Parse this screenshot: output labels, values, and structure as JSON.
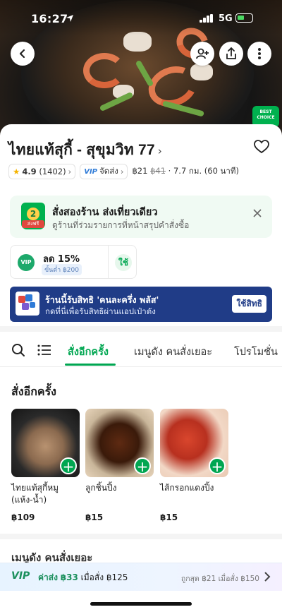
{
  "status_bar": {
    "time": "16:27",
    "network": "5G"
  },
  "store": {
    "name": "ไทยแท้สุกี้ - สุขุมวิท 77",
    "rating": "4.9",
    "review_count": "(1402)",
    "vip_label": "VIP",
    "delivery_label": "จัดส่ง",
    "delivery_fee": "฿21",
    "delivery_fee_original": "฿41",
    "distance_time": "· 7.7 กม. (60 นาที)",
    "badge_text": "BEST CHOICE"
  },
  "promo_banner": {
    "bag_number": "2",
    "bag_tag": "ส่งฟรี",
    "title": "สั่งสองร้าน ส่งเที่ยวเดียว",
    "subtitle": "ดูร้านที่ร่วมรายการที่หน้าสรุปคำสั่งซื้อ"
  },
  "voucher": {
    "badge": "VIP",
    "discount": "ลด 15%",
    "minimum": "ขั้นต่ำ ฿200",
    "use_label": "ใช้"
  },
  "rights_banner": {
    "line1": "ร้านนี้รับสิทธิ 'คนละครึ่ง พลัส'",
    "line2": "กดที่นี่เพื่อรับสิทธิผ่านแอปเป๋าตัง",
    "button": "ใช้สิทธิ"
  },
  "tabs": [
    {
      "label": "สั่งอีกครั้ง"
    },
    {
      "label": "เมนูดัง คนสั่งเยอะ"
    },
    {
      "label": "โปรโมชั่น"
    }
  ],
  "section_title": "สั่งอีกครั้ง",
  "items": [
    {
      "name": "ไทยแท้สุกี้หมู (แห้ง-น้ำ)",
      "price": "฿109"
    },
    {
      "name": "ลูกชิ้นปิ้ง",
      "price": "฿15"
    },
    {
      "name": "ไส้กรอกแดงปิ้ง",
      "price": "฿15"
    }
  ],
  "next_section_peek": "เมนูดัง คนสั่งเยอะ",
  "vip_bar": {
    "tag": "VIP",
    "main_prefix": "ค่าส่ง",
    "main_amount": "฿33",
    "main_suffix": "เมื่อสั่ง ฿125",
    "secondary": "ถูกสุด ฿21 เมื่อสั่ง ฿150"
  },
  "colors": {
    "accent": "#00a651",
    "banner_blue": "#203c87"
  },
  "icons": [
    "back-arrow-icon",
    "add-friend-icon",
    "share-icon",
    "more-icon",
    "heart-icon",
    "star-icon",
    "close-icon",
    "search-icon",
    "list-icon",
    "plus-icon",
    "chevron-right-icon"
  ]
}
